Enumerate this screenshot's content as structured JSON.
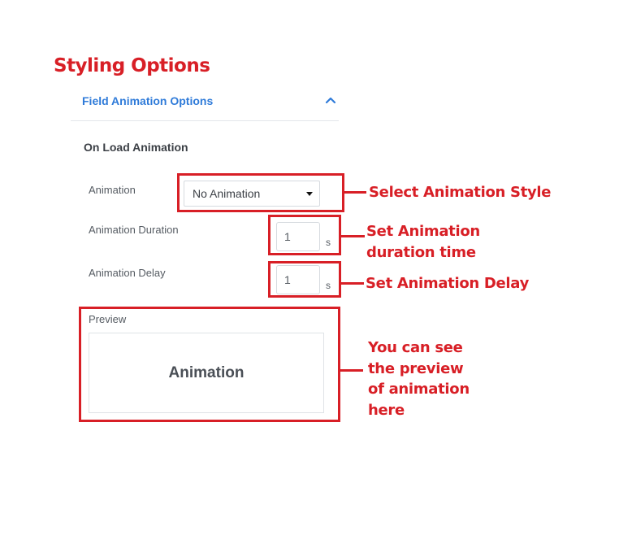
{
  "title": "Styling Options",
  "section": {
    "header": "Field Animation Options",
    "subheading": "On Load Animation"
  },
  "fields": {
    "animation": {
      "label": "Animation",
      "value": "No Animation"
    },
    "duration": {
      "label": "Animation Duration",
      "value": "1",
      "unit": "s"
    },
    "delay": {
      "label": "Animation Delay",
      "value": "1",
      "unit": "s"
    }
  },
  "preview": {
    "label": "Preview",
    "text": "Animation"
  },
  "annotations": {
    "select_style": "Select Animation Style",
    "duration": "Set Animation\nduration time",
    "delay": "Set Animation Delay",
    "preview": "You can see\nthe preview\nof animation\nhere"
  },
  "colors": {
    "annotation_red": "#d81f26",
    "link_blue": "#2f7bd9"
  },
  "icons": {
    "collapse": "chevron-up-icon",
    "dropdown": "caret-down-icon"
  }
}
